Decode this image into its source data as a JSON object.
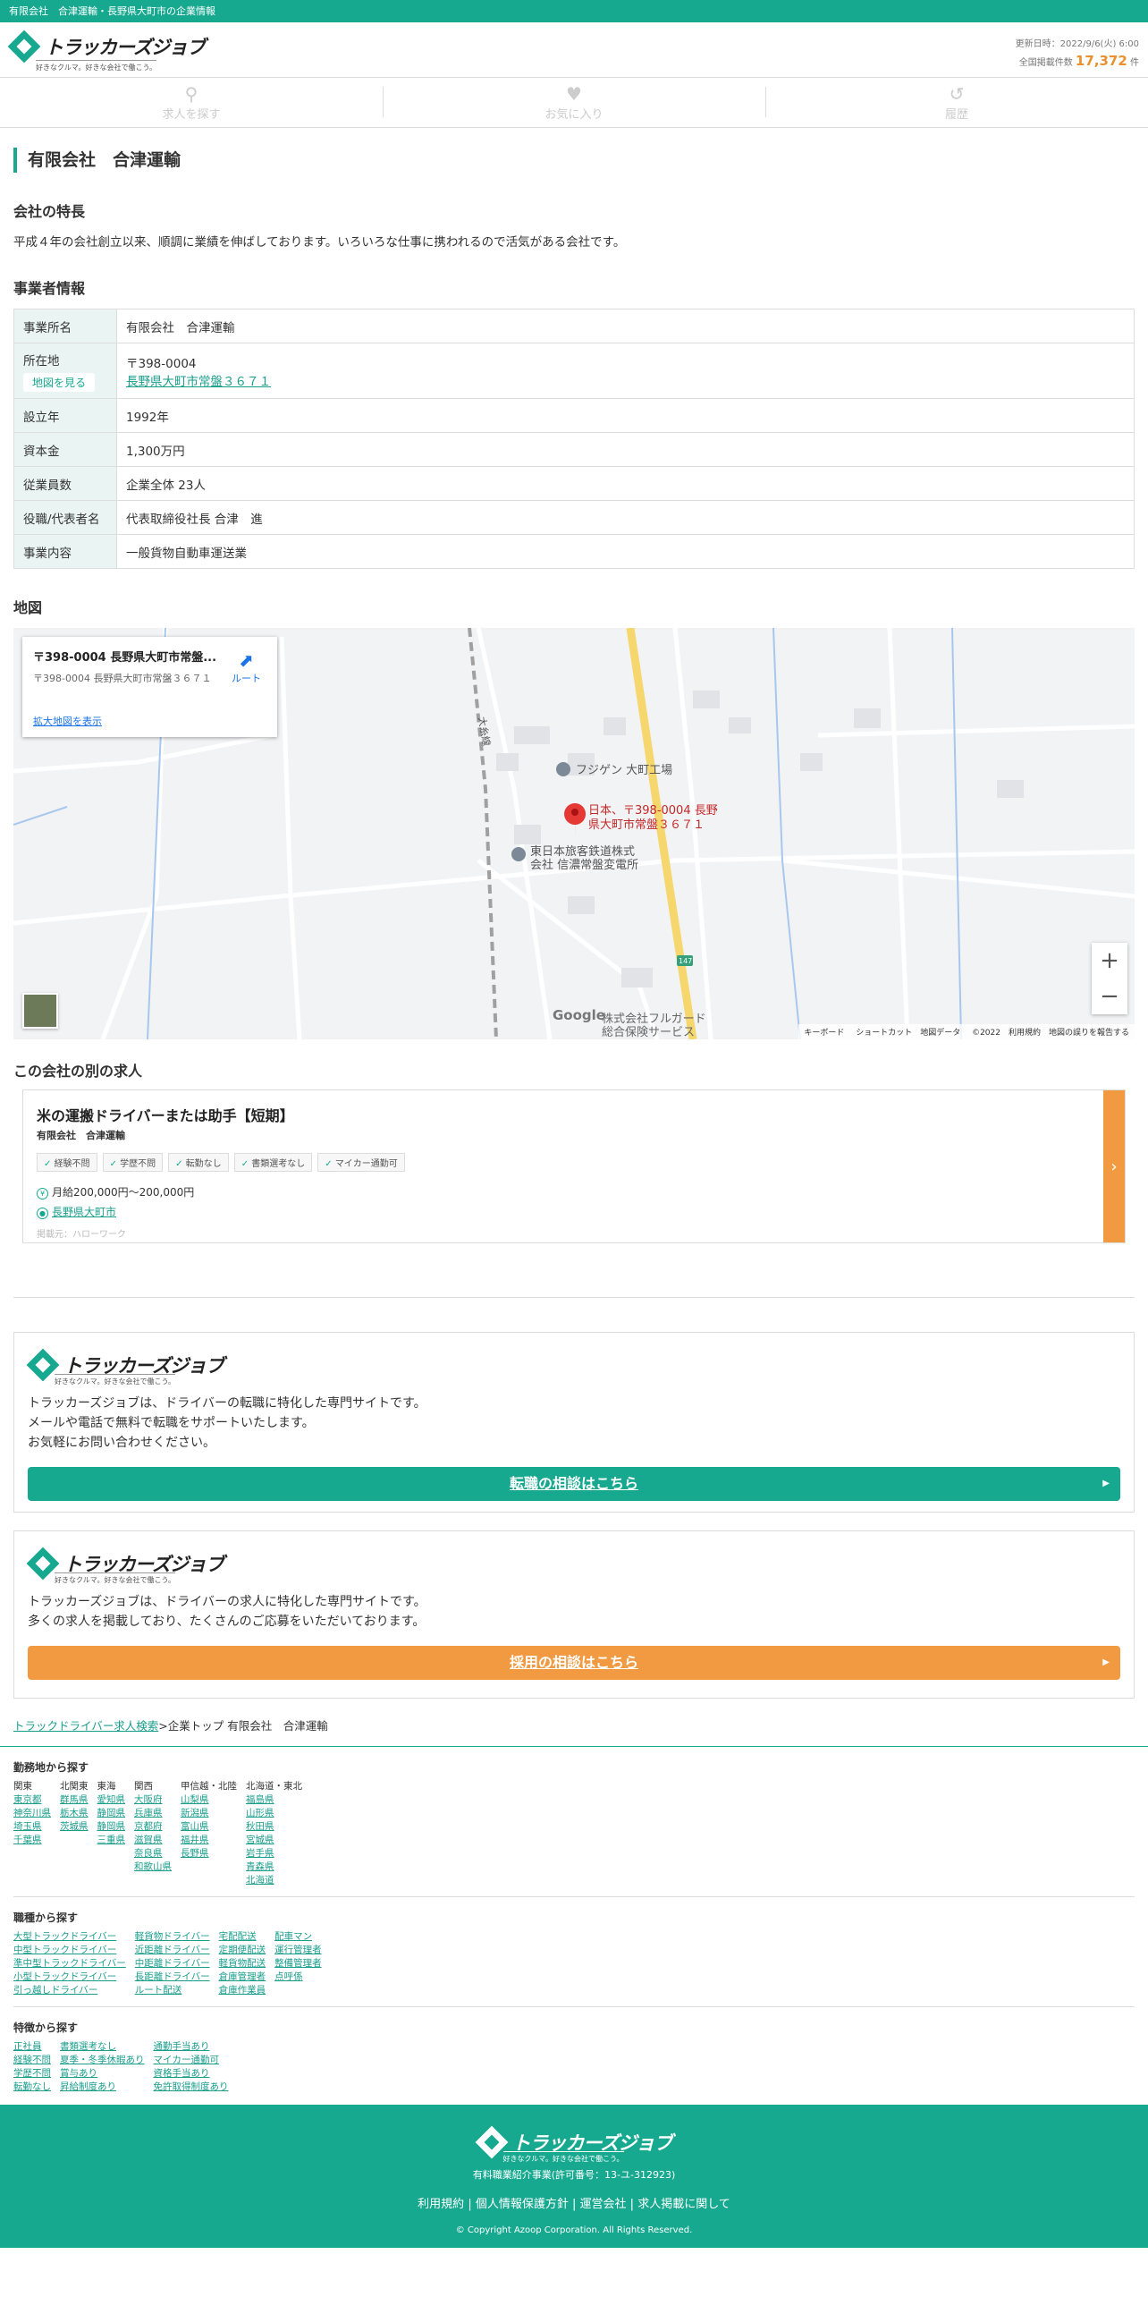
{
  "topbar": {
    "text": "有限会社　合津運輸・長野県大町市の企業情報"
  },
  "header": {
    "logo_text": "トラッカーズジョブ",
    "logo_sub": "好きなクルマ。好きな会社で働こう。",
    "updated": "更新日時：2022/9/6(火) 6:00",
    "count_label": "全国掲載件数",
    "count": "17,372",
    "count_unit": "件"
  },
  "nav": {
    "search": "求人を探す",
    "favorites": "お気に入り",
    "history": "履歴"
  },
  "page_title": "有限会社　合津運輸",
  "features": {
    "heading": "会社の特長",
    "text": "平成４年の会社創立以来、順調に業績を伸ばしております。いろいろな仕事に携われるので活気がある会社です。"
  },
  "business": {
    "heading": "事業者情報",
    "rows": [
      {
        "label": "事業所名",
        "value": "有限会社　合津運輸"
      },
      {
        "label": "所在地",
        "map_button": "地図を見る",
        "zip": "〒398-0004",
        "address": "長野県大町市常盤３６７１"
      },
      {
        "label": "設立年",
        "value": "1992年"
      },
      {
        "label": "資本金",
        "value": "1,300万円"
      },
      {
        "label": "従業員数",
        "value": "企業全体 23人"
      },
      {
        "label": "役職/代表者名",
        "value": "代表取締役社長 合津　進"
      },
      {
        "label": "事業内容",
        "value": "一般貨物自動車運送業"
      }
    ]
  },
  "map": {
    "heading": "地図",
    "card_title": "〒398-0004 長野県大町市常盤...",
    "card_address": "〒398-0004 長野県大町市常盤３６７１",
    "route": "ルート",
    "enlarge": "拡大地図を表示",
    "rail_label": "大糸線",
    "poi1": "フジゲン 大町工場",
    "pin_label_1": "日本、〒398-0004 長野",
    "pin_label_2": "県大町市常盤３６７１",
    "poi2_1": "東日本旅客鉄道株式",
    "poi2_2": "会社 信濃常盤変電所",
    "poi3_1": "株式会社フルガード",
    "poi3_2": "総合保険サービス",
    "road": "147",
    "google": "Google",
    "footer": "キーボード ショートカット　地図データ ©2022　利用規約　地図の誤りを報告する"
  },
  "jobs": {
    "heading": "この会社の別の求人",
    "items": [
      {
        "title": "米の運搬ドライバーまたは助手【短期】",
        "company": "有限会社　合津運輸",
        "tags": [
          "経験不問",
          "学歴不問",
          "転勤なし",
          "書類選考なし",
          "マイカー通勤可"
        ],
        "salary": "月給200,000円〜200,000円",
        "location": "長野県大町市",
        "source": "掲載元：ハローワーク"
      }
    ]
  },
  "promo1": {
    "text": [
      "トラッカーズジョブは、ドライバーの転職に特化した専門サイトです。",
      "メールや電話で無料で転職をサポートいたします。",
      "お気軽にお問い合わせください。"
    ],
    "button": "転職の相談はこちら"
  },
  "promo2": {
    "text": [
      "トラッカーズジョブは、ドライバーの求人に特化した専門サイトです。",
      "多くの求人を掲載しており、たくさんのご応募をいただいております。"
    ],
    "button": "採用の相談はこちら"
  },
  "breadcrumb": {
    "link": "トラックドライバー求人検索",
    "sep": ">",
    "current": "企業トップ 有限会社　合津運輸"
  },
  "sitemap": {
    "area_heading": "勤務地から探す",
    "areas": [
      {
        "name": "関東",
        "items": [
          "東京都",
          "神奈川県",
          "埼玉県",
          "千葉県"
        ]
      },
      {
        "name": "北関東",
        "items": [
          "群馬県",
          "栃木県",
          "茨城県"
        ]
      },
      {
        "name": "東海",
        "items": [
          "愛知県",
          "静岡県",
          "静岡県",
          "三重県"
        ]
      },
      {
        "name": "関西",
        "items": [
          "大阪府",
          "兵庫県",
          "京都府",
          "滋賀県",
          "奈良県",
          "和歌山県"
        ]
      },
      {
        "name": "甲信越・北陸",
        "items": [
          "山梨県",
          "新潟県",
          "富山県",
          "福井県",
          "長野県"
        ]
      },
      {
        "name": "北海道・東北",
        "items": [
          "福島県",
          "山形県",
          "秋田県",
          "宮城県",
          "岩手県",
          "青森県",
          "北海道"
        ]
      }
    ],
    "type_heading": "職種から探す",
    "types": [
      [
        "大型トラックドライバー",
        "中型トラックドライバー",
        "準中型トラックドライバー",
        "小型トラックドライバー",
        "引っ越しドライバー"
      ],
      [
        "軽貨物ドライバー",
        "近距離ドライバー",
        "中距離ドライバー",
        "長距離ドライバー",
        "ルート配送"
      ],
      [
        "宅配配送",
        "定期便配送",
        "軽貨物配送",
        "倉庫管理者",
        "倉庫作業員"
      ],
      [
        "配車マン",
        "運行管理者",
        "整備管理者",
        "点呼係"
      ]
    ],
    "feature_heading": "特徴から探す",
    "features": [
      [
        "正社員",
        "経験不問",
        "学歴不問",
        "転勤なし"
      ],
      [
        "書類選考なし",
        "夏季・冬季休暇あり",
        "賞与あり",
        "昇給制度あり"
      ],
      [
        "通勤手当あり",
        "マイカー通勤可",
        "資格手当あり",
        "免許取得制度あり"
      ]
    ]
  },
  "footer": {
    "license": "有料職業紹介事業(許可番号：13-ユ-312923)",
    "links": [
      "利用規約",
      "個人情報保護方針",
      "運営会社",
      "求人掲載に関して"
    ],
    "copyright": "© Copyright Azoop Corporation. All Rights Reserved."
  }
}
